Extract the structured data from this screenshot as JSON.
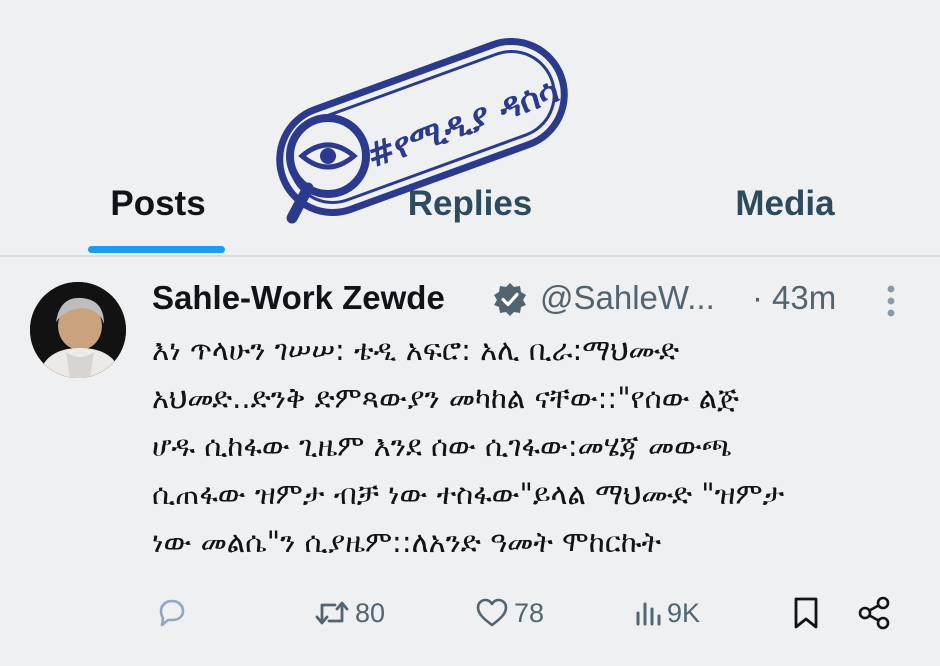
{
  "tabs": [
    {
      "label": "Posts",
      "active": true
    },
    {
      "label": "Replies",
      "active": false
    },
    {
      "label": "Media",
      "active": false
    }
  ],
  "stamp": {
    "text": "#የሚዲያ ዳሰሳ",
    "icon": "magnifier-eye-icon",
    "color": "#2b3a8c"
  },
  "tweet": {
    "author_name": "Sahle-Work Zewde",
    "verified": true,
    "handle": "@SahleW...",
    "separator": "·",
    "time": "43m",
    "text": "እነ ጥላሁን ገሠሠ: ቴዲ አፍሮ: አሊ ቢራ:ማህሙድ\nአህመድ..ድንቅ ድምጻውያን መካከል ናቸው::\"የሰው ልጅ\nሆዱ ሲከፋው ጊዜም እንደ ሰው ሲገፋው:መሄጃ መውጫ\nሲጠፋው ዝምታ ብቻ ነው ተስፋው\"ይላል ማህሙድ \"ዝምታ\nነው መልሴ\"ን ሲያዜም::ለአንድ ዓመት ሞከርኩት",
    "actions": {
      "replies": "",
      "reposts": "80",
      "likes": "78",
      "views": "9K"
    }
  },
  "colors": {
    "accent": "#1d9bf0",
    "background": "#eef0f1",
    "muted_text": "#536471",
    "verified_badge": "#536471"
  }
}
